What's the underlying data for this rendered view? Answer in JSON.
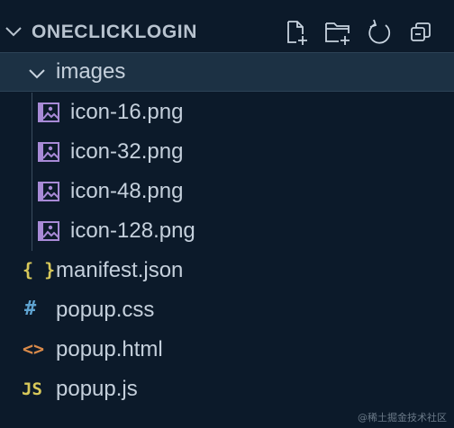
{
  "explorer": {
    "section_title": "ONECLICKLOGIN",
    "actions": [
      {
        "name": "new-file-icon"
      },
      {
        "name": "new-folder-icon"
      },
      {
        "name": "refresh-icon"
      },
      {
        "name": "collapse-all-icon"
      }
    ],
    "folder": {
      "label": "images",
      "expanded": true,
      "icon": "chevron-down-icon"
    },
    "images_children": [
      {
        "label": "icon-16.png",
        "icon": "image-file-icon"
      },
      {
        "label": "icon-32.png",
        "icon": "image-file-icon"
      },
      {
        "label": "icon-48.png",
        "icon": "image-file-icon"
      },
      {
        "label": "icon-128.png",
        "icon": "image-file-icon"
      }
    ],
    "root_files": [
      {
        "label": "manifest.json",
        "glyph": "{ }",
        "icon": "json-file-icon",
        "color": "#d7c85a"
      },
      {
        "label": "popup.css",
        "glyph": "#",
        "icon": "css-file-icon",
        "color": "#5fa3d0"
      },
      {
        "label": "popup.html",
        "glyph": "<>",
        "icon": "html-file-icon",
        "color": "#d98a4a"
      },
      {
        "label": "popup.js",
        "glyph": "JS",
        "icon": "js-file-icon",
        "color": "#d7c85a"
      }
    ]
  },
  "colors": {
    "background": "#0c1a2a",
    "selected_row": "#1c3144",
    "image_icon": "#a88ad6",
    "text": "#c5d0dc"
  },
  "watermark": "@稀土掘金技术社区"
}
